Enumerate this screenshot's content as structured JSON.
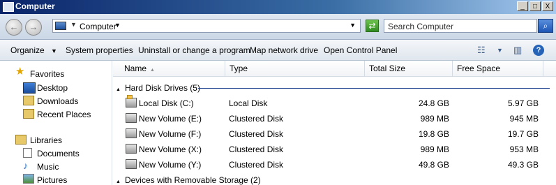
{
  "window": {
    "title": "Computer",
    "minimize": "_",
    "maximize": "□",
    "close": "X"
  },
  "address": {
    "crumb": "Computer",
    "search_placeholder": "Search Computer"
  },
  "toolbar": {
    "organize": "Organize",
    "system_properties": "System properties",
    "uninstall": "Uninstall or change a program",
    "map_drive": "Map network drive",
    "control_panel": "Open Control Panel"
  },
  "nav": {
    "favorites": "Favorites",
    "desktop": "Desktop",
    "downloads": "Downloads",
    "recent_places": "Recent Places",
    "libraries": "Libraries",
    "documents": "Documents",
    "music": "Music",
    "pictures": "Pictures"
  },
  "columns": {
    "name": "Name",
    "type": "Type",
    "total_size": "Total Size",
    "free_space": "Free Space"
  },
  "groups": {
    "hdd": "Hard Disk Drives (5)",
    "removable": "Devices with Removable Storage (2)"
  },
  "rows": [
    {
      "name": "Local Disk (C:)",
      "type": "Local Disk",
      "total": "24.8 GB",
      "free": "5.97 GB"
    },
    {
      "name": "New Volume (E:)",
      "type": "Clustered Disk",
      "total": "989 MB",
      "free": "945 MB"
    },
    {
      "name": "New Volume (F:)",
      "type": "Clustered Disk",
      "total": "19.8 GB",
      "free": "19.7 GB"
    },
    {
      "name": "New Volume (X:)",
      "type": "Clustered Disk",
      "total": "989 MB",
      "free": "953 MB"
    },
    {
      "name": "New Volume (Y:)",
      "type": "Clustered Disk",
      "total": "49.8 GB",
      "free": "49.3 GB"
    }
  ]
}
